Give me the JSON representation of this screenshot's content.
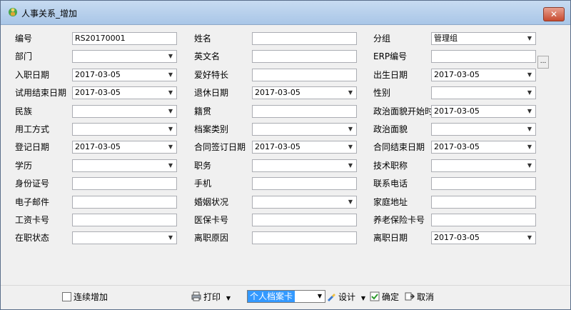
{
  "window": {
    "title": "人事关系_增加",
    "close": "✕"
  },
  "form": {
    "col1": [
      {
        "label": "编号",
        "type": "text",
        "value": "RS20170001"
      },
      {
        "label": "部门",
        "type": "select",
        "value": ""
      },
      {
        "label": "入职日期",
        "type": "select",
        "value": "2017-03-05"
      },
      {
        "label": "试用结束日期",
        "type": "select",
        "value": "2017-03-05"
      },
      {
        "label": "民族",
        "type": "select",
        "value": ""
      },
      {
        "label": "用工方式",
        "type": "select",
        "value": ""
      },
      {
        "label": "登记日期",
        "type": "select",
        "value": "2017-03-05"
      },
      {
        "label": "学历",
        "type": "select",
        "value": ""
      },
      {
        "label": "身份证号",
        "type": "text",
        "value": ""
      },
      {
        "label": "电子邮件",
        "type": "text",
        "value": ""
      },
      {
        "label": "工资卡号",
        "type": "text",
        "value": ""
      },
      {
        "label": "在职状态",
        "type": "select",
        "value": ""
      }
    ],
    "col2": [
      {
        "label": "姓名",
        "type": "text",
        "value": ""
      },
      {
        "label": "英文名",
        "type": "text",
        "value": ""
      },
      {
        "label": "爱好特长",
        "type": "text",
        "value": ""
      },
      {
        "label": "退休日期",
        "type": "select",
        "value": "2017-03-05"
      },
      {
        "label": "籍贯",
        "type": "text",
        "value": ""
      },
      {
        "label": "档案类别",
        "type": "select",
        "value": ""
      },
      {
        "label": "合同签订日期",
        "type": "select",
        "value": "2017-03-05"
      },
      {
        "label": "职务",
        "type": "select",
        "value": ""
      },
      {
        "label": "手机",
        "type": "text",
        "value": ""
      },
      {
        "label": "婚姻状况",
        "type": "select",
        "value": ""
      },
      {
        "label": "医保卡号",
        "type": "text",
        "value": ""
      },
      {
        "label": "离职原因",
        "type": "text",
        "value": ""
      }
    ],
    "col3": [
      {
        "label": "分组",
        "type": "select",
        "value": "管理组"
      },
      {
        "label": "ERP编号",
        "type": "text",
        "value": ""
      },
      {
        "label": "出生日期",
        "type": "select",
        "value": "2017-03-05"
      },
      {
        "label": "性别",
        "type": "select",
        "value": ""
      },
      {
        "label": "政治面貌开始时",
        "type": "select",
        "value": "2017-03-05"
      },
      {
        "label": "政治面貌",
        "type": "select",
        "value": ""
      },
      {
        "label": "合同结束日期",
        "type": "select",
        "value": "2017-03-05"
      },
      {
        "label": "技术职称",
        "type": "select",
        "value": ""
      },
      {
        "label": "联系电话",
        "type": "text",
        "value": ""
      },
      {
        "label": "家庭地址",
        "type": "text",
        "value": ""
      },
      {
        "label": "养老保险卡号",
        "type": "text",
        "value": ""
      },
      {
        "label": "离职日期",
        "type": "select",
        "value": "2017-03-05"
      }
    ],
    "group_more": "..."
  },
  "bottom": {
    "continue_add": "连续增加",
    "print": "打印",
    "template_value": "个人档案卡",
    "design": "设计",
    "ok": "确定",
    "cancel": "取消"
  },
  "icons": {
    "app": "app-icon",
    "print": "printer-icon",
    "design": "design-icon",
    "ok": "ok-icon",
    "cancel": "cancel-icon"
  }
}
